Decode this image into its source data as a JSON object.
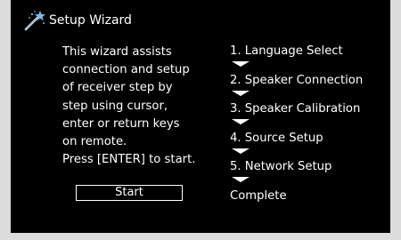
{
  "header": {
    "title": "Setup Wizard",
    "icon": "magic-wand-icon"
  },
  "description": {
    "lines": [
      "This wizard assists",
      "connection and setup",
      "of receiver step by",
      "step using cursor,",
      "enter or return keys",
      "on remote.",
      "Press [ENTER] to start."
    ]
  },
  "start_button": {
    "label": "Start"
  },
  "steps": [
    "1. Language Select",
    "2. Speaker Connection",
    "3. Speaker Calibration",
    "4. Source Setup",
    "5. Network Setup",
    "Complete"
  ],
  "colors": {
    "background": "#000000",
    "text": "#ffffff",
    "frame": "#dcdcdc",
    "icon_accent": "#7fb8e6"
  }
}
